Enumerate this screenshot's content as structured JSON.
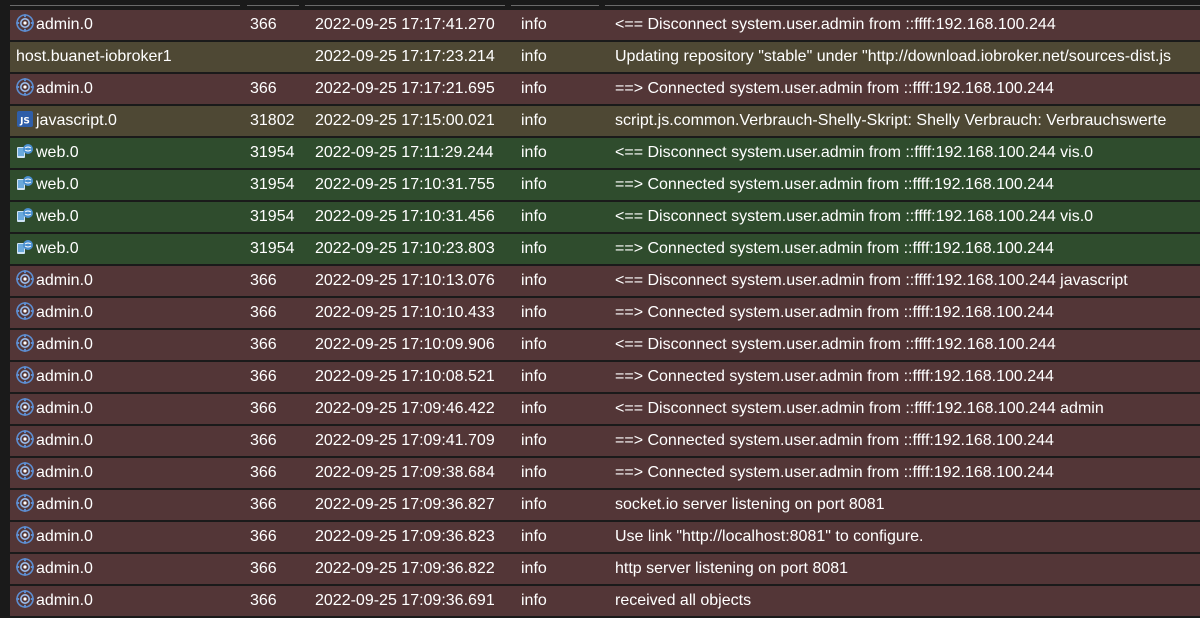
{
  "icons": {
    "admin": "admin-gear-icon",
    "javascript": "javascript-js-icon",
    "web": "web-adapter-icon"
  },
  "colors": {
    "admin_row": "#533637",
    "host_row": "#4e4834",
    "javascript_row": "#4e4834",
    "web_row": "#2f4c2d",
    "text": "#ffffff"
  },
  "log": {
    "rows": [
      {
        "source": "admin.0",
        "icon": "admin",
        "pid": "366",
        "time": "2022-09-25 17:17:41.270",
        "severity": "info",
        "message": "<== Disconnect system.user.admin from ::ffff:192.168.100.244"
      },
      {
        "source": "host.buanet-iobroker1",
        "icon": "",
        "pid": "",
        "time": "2022-09-25 17:17:23.214",
        "severity": "info",
        "message": "Updating repository \"stable\" under \"http://download.iobroker.net/sources-dist.js"
      },
      {
        "source": "admin.0",
        "icon": "admin",
        "pid": "366",
        "time": "2022-09-25 17:17:21.695",
        "severity": "info",
        "message": "==> Connected system.user.admin from ::ffff:192.168.100.244"
      },
      {
        "source": "javascript.0",
        "icon": "javascript",
        "pid": "31802",
        "time": "2022-09-25 17:15:00.021",
        "severity": "info",
        "message": "script.js.common.Verbrauch-Shelly-Skript: Shelly Verbrauch: Verbrauchswerte"
      },
      {
        "source": "web.0",
        "icon": "web",
        "pid": "31954",
        "time": "2022-09-25 17:11:29.244",
        "severity": "info",
        "message": "<== Disconnect system.user.admin from ::ffff:192.168.100.244 vis.0"
      },
      {
        "source": "web.0",
        "icon": "web",
        "pid": "31954",
        "time": "2022-09-25 17:10:31.755",
        "severity": "info",
        "message": "==> Connected system.user.admin from ::ffff:192.168.100.244"
      },
      {
        "source": "web.0",
        "icon": "web",
        "pid": "31954",
        "time": "2022-09-25 17:10:31.456",
        "severity": "info",
        "message": "<== Disconnect system.user.admin from ::ffff:192.168.100.244 vis.0"
      },
      {
        "source": "web.0",
        "icon": "web",
        "pid": "31954",
        "time": "2022-09-25 17:10:23.803",
        "severity": "info",
        "message": "==> Connected system.user.admin from ::ffff:192.168.100.244"
      },
      {
        "source": "admin.0",
        "icon": "admin",
        "pid": "366",
        "time": "2022-09-25 17:10:13.076",
        "severity": "info",
        "message": "<== Disconnect system.user.admin from ::ffff:192.168.100.244 javascript"
      },
      {
        "source": "admin.0",
        "icon": "admin",
        "pid": "366",
        "time": "2022-09-25 17:10:10.433",
        "severity": "info",
        "message": "==> Connected system.user.admin from ::ffff:192.168.100.244"
      },
      {
        "source": "admin.0",
        "icon": "admin",
        "pid": "366",
        "time": "2022-09-25 17:10:09.906",
        "severity": "info",
        "message": "<== Disconnect system.user.admin from ::ffff:192.168.100.244"
      },
      {
        "source": "admin.0",
        "icon": "admin",
        "pid": "366",
        "time": "2022-09-25 17:10:08.521",
        "severity": "info",
        "message": "==> Connected system.user.admin from ::ffff:192.168.100.244"
      },
      {
        "source": "admin.0",
        "icon": "admin",
        "pid": "366",
        "time": "2022-09-25 17:09:46.422",
        "severity": "info",
        "message": "<== Disconnect system.user.admin from ::ffff:192.168.100.244 admin"
      },
      {
        "source": "admin.0",
        "icon": "admin",
        "pid": "366",
        "time": "2022-09-25 17:09:41.709",
        "severity": "info",
        "message": "==> Connected system.user.admin from ::ffff:192.168.100.244"
      },
      {
        "source": "admin.0",
        "icon": "admin",
        "pid": "366",
        "time": "2022-09-25 17:09:38.684",
        "severity": "info",
        "message": "==> Connected system.user.admin from ::ffff:192.168.100.244"
      },
      {
        "source": "admin.0",
        "icon": "admin",
        "pid": "366",
        "time": "2022-09-25 17:09:36.827",
        "severity": "info",
        "message": "socket.io server listening on port 8081"
      },
      {
        "source": "admin.0",
        "icon": "admin",
        "pid": "366",
        "time": "2022-09-25 17:09:36.823",
        "severity": "info",
        "message": "Use link \"http://localhost:8081\" to configure."
      },
      {
        "source": "admin.0",
        "icon": "admin",
        "pid": "366",
        "time": "2022-09-25 17:09:36.822",
        "severity": "info",
        "message": "http server listening on port 8081"
      },
      {
        "source": "admin.0",
        "icon": "admin",
        "pid": "366",
        "time": "2022-09-25 17:09:36.691",
        "severity": "info",
        "message": "received all objects"
      }
    ]
  }
}
